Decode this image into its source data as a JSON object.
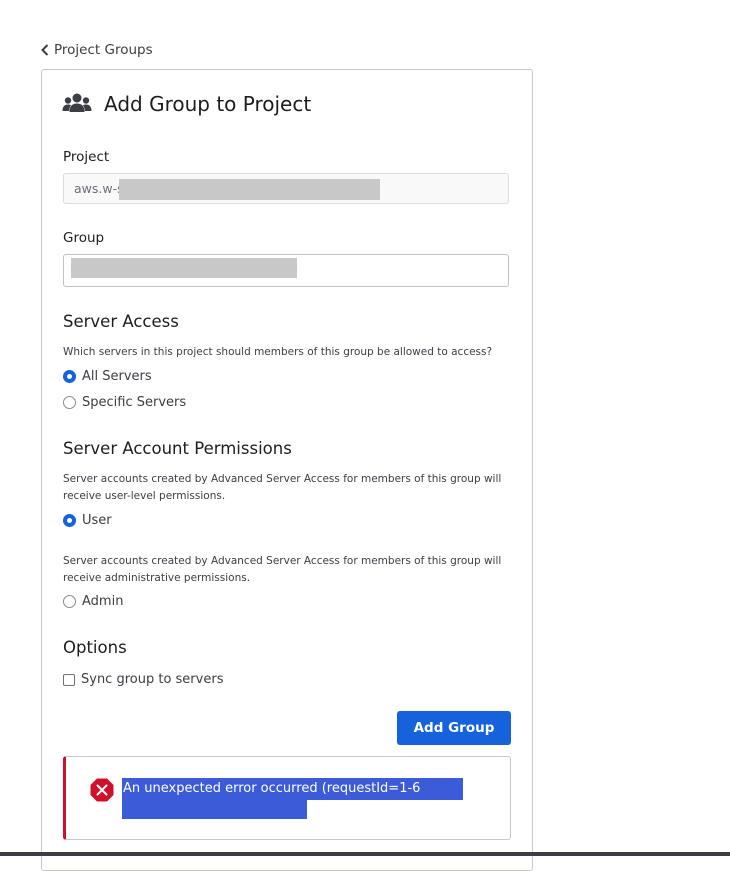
{
  "nav": {
    "back_label": "Project Groups"
  },
  "page": {
    "title": "Add Group to Project"
  },
  "form": {
    "project_label": "Project",
    "project_value": "aws.w-s",
    "group_label": "Group",
    "group_value": ""
  },
  "server_access": {
    "title": "Server Access",
    "help": "Which servers in this project should members of this group be allowed to access?",
    "options": [
      {
        "label": "All Servers",
        "checked": true
      },
      {
        "label": "Specific Servers",
        "checked": false
      }
    ]
  },
  "permissions": {
    "title": "Server Account Permissions",
    "user_help": "Server accounts created by Advanced Server Access for members of this group will receive user-level permissions.",
    "user_label": "User",
    "user_checked": true,
    "admin_help": "Server accounts created by Advanced Server Access for members of this group will receive administrative permissions.",
    "admin_label": "Admin",
    "admin_checked": false
  },
  "options": {
    "title": "Options",
    "sync_label": "Sync group to servers",
    "sync_checked": false
  },
  "actions": {
    "submit_label": "Add Group"
  },
  "error": {
    "message": "An unexpected error occurred (requestId=1-6"
  },
  "colors": {
    "primary": "#1662dd",
    "error": "#d0112b",
    "selection": "#3b5bd8"
  },
  "icons": {
    "back": "chevron-left-icon",
    "title": "users-group-icon",
    "error": "error-x-icon"
  }
}
